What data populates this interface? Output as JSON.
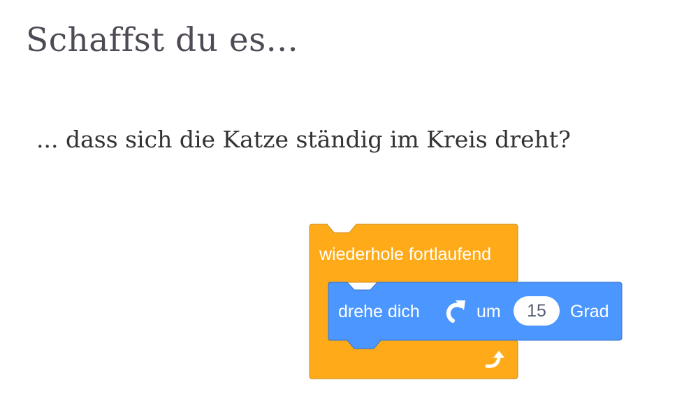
{
  "slide": {
    "title": "Schaffst du es...",
    "subtitle": "... dass sich die Katze ständig im Kreis dreht?"
  },
  "blocks": {
    "loop": {
      "label": "wiederhole fortlaufend",
      "color": "#FFAB19",
      "icon": "loop-arrow-icon"
    },
    "turn": {
      "label_before": "drehe dich",
      "icon": "rotate-clockwise-icon",
      "label_mid": "um",
      "value": "15",
      "label_after": "Grad",
      "color": "#4C97FF"
    }
  }
}
